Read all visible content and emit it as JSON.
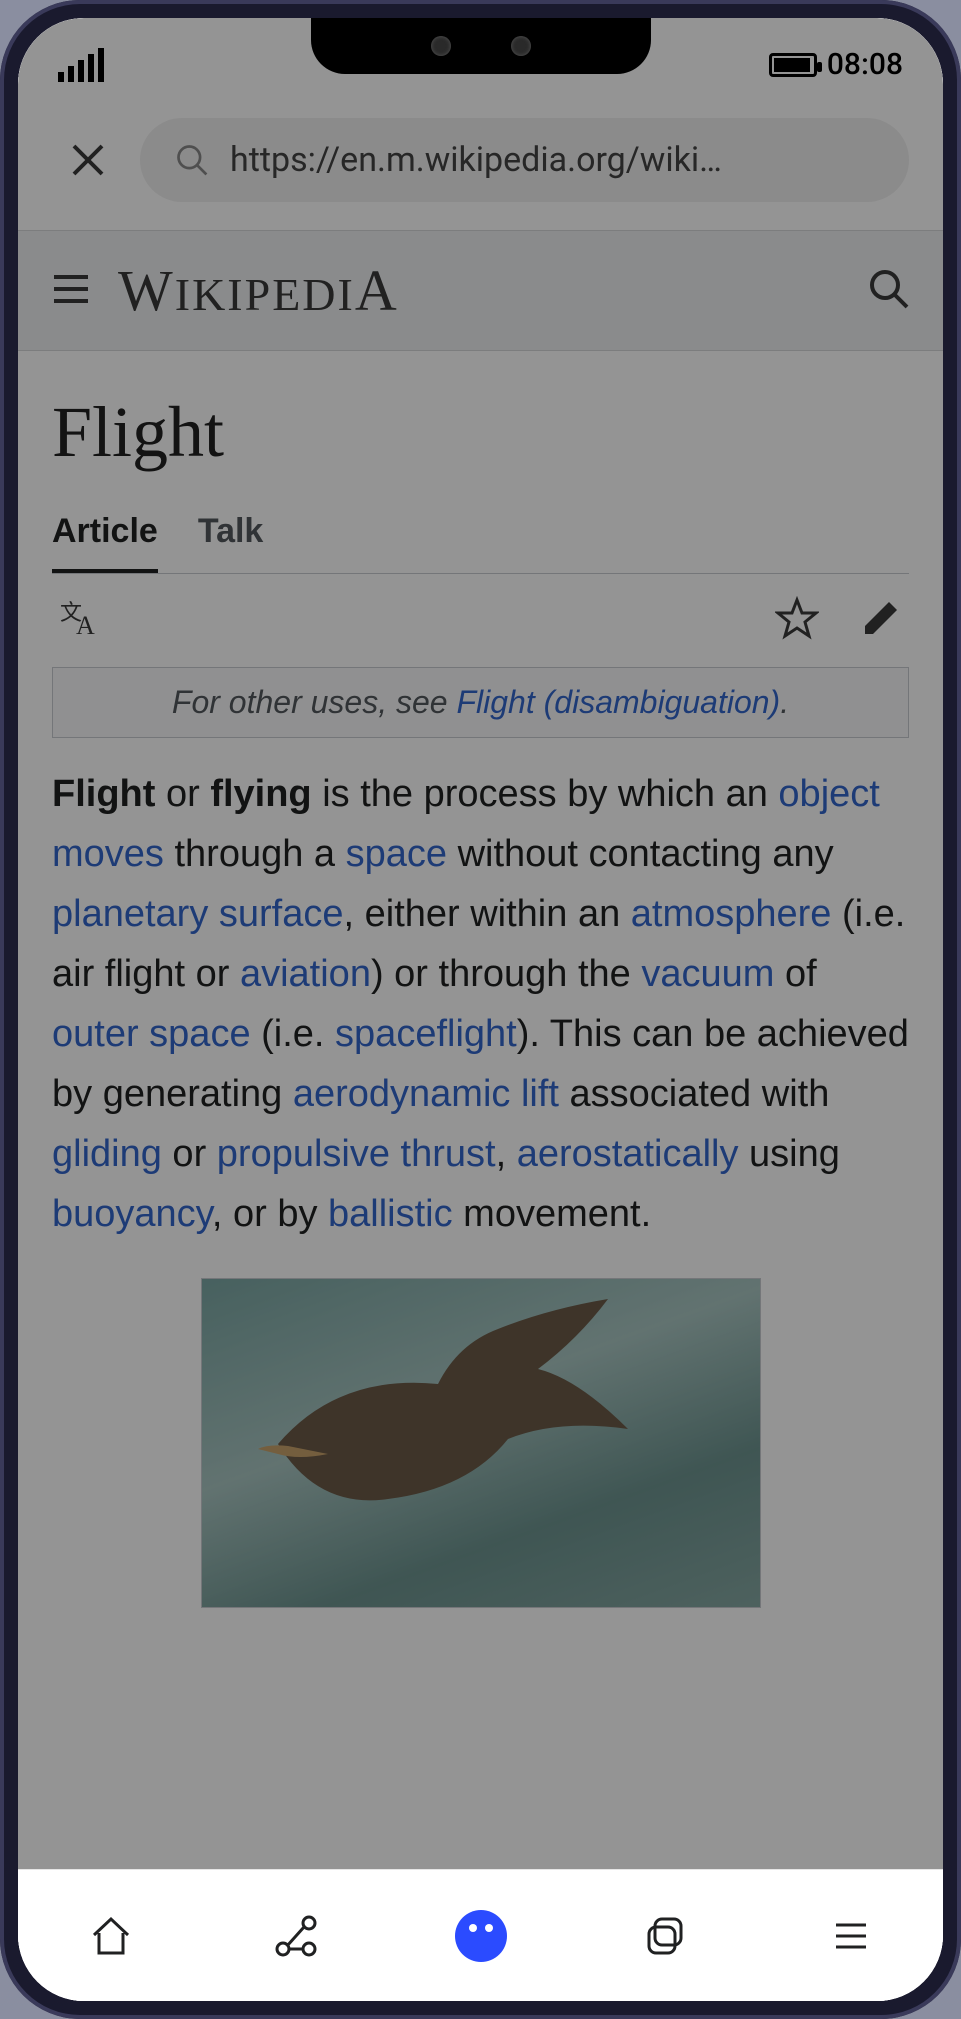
{
  "status": {
    "time": "08:08"
  },
  "browser": {
    "url": "https://en.m.wikipedia.org/wiki…"
  },
  "wiki_header": {
    "logo_text": "WikipediA"
  },
  "article": {
    "title": "Flight",
    "tabs": {
      "article": "Article",
      "talk": "Talk"
    },
    "hatnote_prefix": "For other uses, see ",
    "hatnote_link": "Flight (disambiguation)",
    "hatnote_suffix": ".",
    "para": {
      "b1": "Flight",
      "t1": " or ",
      "b2": "flying",
      "t2": " is the process by which an ",
      "l1": "object",
      "t3": " ",
      "l2": "moves",
      "t4": " through a ",
      "l3": "space",
      "t5": " without contacting any ",
      "l4": "planetary surface",
      "t6": ", either within an ",
      "l5": "atmosphere",
      "t7": " (i.e. air flight or ",
      "l6": "aviation",
      "t8": ") or through the ",
      "l7": "vacuum",
      "t9": " of ",
      "l8": "outer space",
      "t10": " (i.e. ",
      "l9": "spaceflight",
      "t11": "). This can be achieved by generating ",
      "l10": "aerodynamic lift",
      "t12": " associated with ",
      "l11": "gliding",
      "t13": " or ",
      "l12": "propulsive thrust",
      "t14": ", ",
      "l13": "aerostatically",
      "t15": " using ",
      "l14": "buoyancy",
      "t16": ", or by ",
      "l15": "ballistic",
      "t17": " movement."
    }
  },
  "colors": {
    "link": "#3366cc",
    "accent": "#2b4bff"
  }
}
